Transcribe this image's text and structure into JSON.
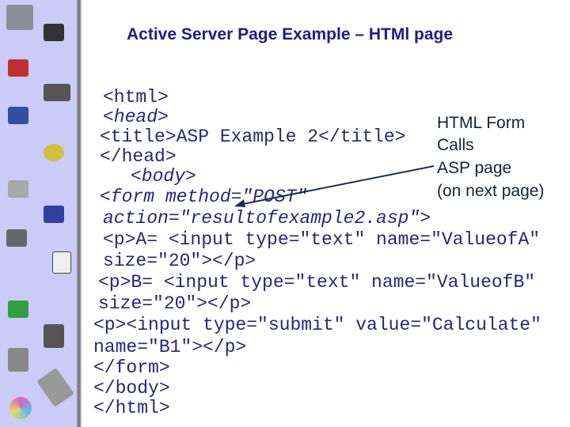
{
  "title": "Active Server Page Example – HTMl page",
  "code_lines": [
    "<html>",
    "<head>",
    "<title>ASP Example 2</title>",
    "</head>",
    "<body>",
    "<form method=\"POST\"",
    "action=\"resultofexample2.asp\">",
    "<p>A= <input type=\"text\" name=\"ValueofA\"",
    "size=\"20\"></p>",
    "<p>B= <input type=\"text\" name=\"ValueofB\"",
    "size=\"20\"></p>",
    "<p><input type=\"submit\" value=\"Calculate\"",
    "name=\"B1\"></p>",
    "</form>",
    "</body>",
    "</html>"
  ],
  "annotation": [
    "HTML Form",
    "Calls",
    "ASP page",
    "(on next page)"
  ],
  "sidebar_icons": [
    "gauge-icon",
    "network-icon",
    "connector-icon",
    "chip-icon",
    "networked-computers-icon",
    "globe-phone-icon",
    "modem-icon",
    "computer-icon",
    "cables-icon",
    "wall-jack-icon",
    "circuit-board-icon",
    "floppy-disk-icon",
    "desktop-computer-icon",
    "keyboard-icon",
    "cd-icon"
  ]
}
